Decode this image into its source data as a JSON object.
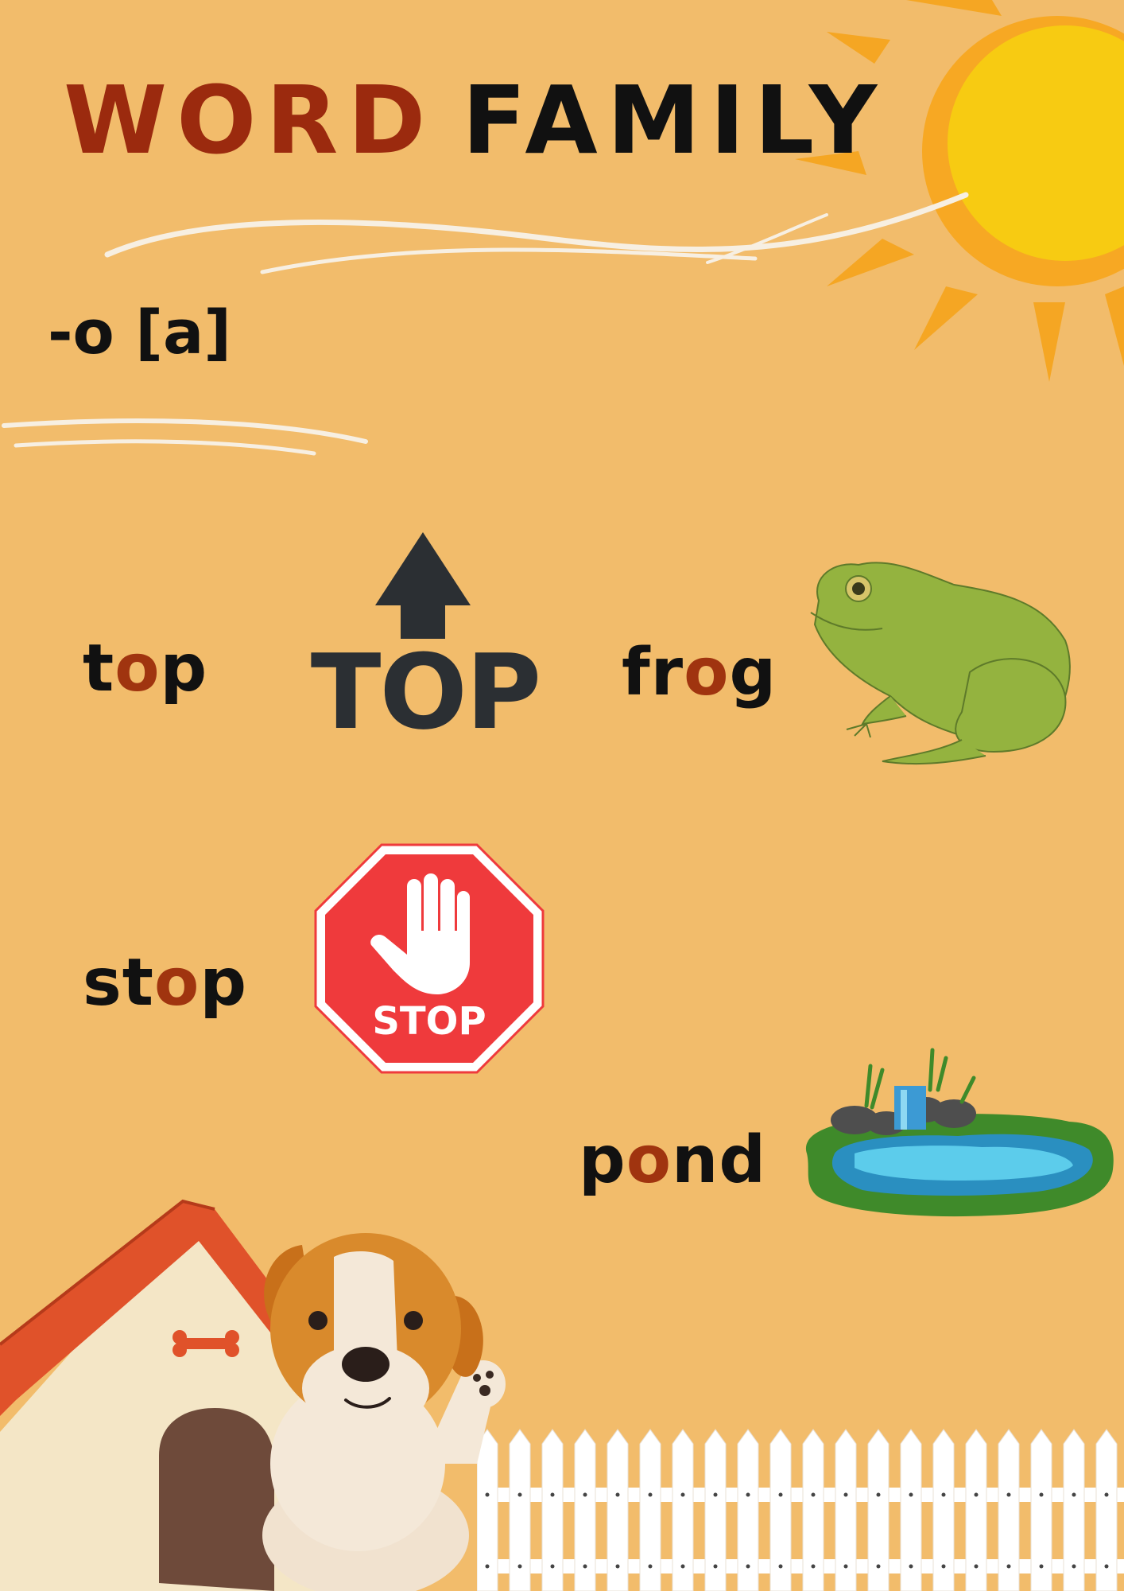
{
  "title": {
    "word1": "WORD",
    "word2": "FAMILY"
  },
  "subtitle": "-o [a]",
  "words": [
    {
      "pre": "t",
      "vowel": "o",
      "post": "p"
    },
    {
      "pre": "fr",
      "vowel": "o",
      "post": "g"
    },
    {
      "pre": "st",
      "vowel": "o",
      "post": "p"
    },
    {
      "pre": "p",
      "vowel": "o",
      "post": "nd"
    }
  ],
  "signs": {
    "top_label": "TOP",
    "stop_label": "STOP"
  },
  "colors": {
    "background": "#F2BC6B",
    "title_accent": "#9B2A0E",
    "vowel_highlight": "#A0340F",
    "sun": "#F7CB12",
    "stop_red": "#EF3A3C"
  },
  "icons": [
    "sun-icon",
    "up-arrow-icon",
    "frog-icon",
    "stop-sign-icon",
    "pond-icon",
    "doghouse-icon",
    "dog-icon",
    "fence-icon"
  ]
}
